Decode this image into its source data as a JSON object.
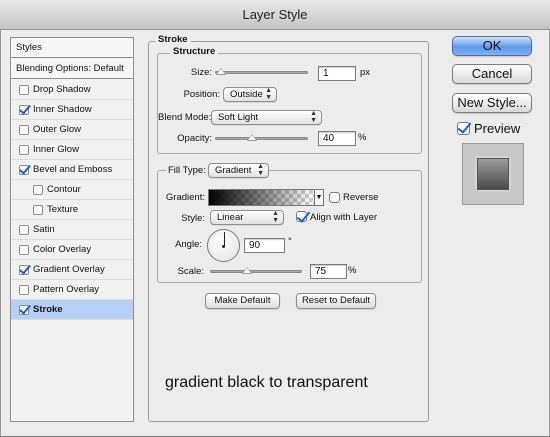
{
  "window": {
    "title": "Layer Style"
  },
  "styles_list": {
    "header": "Styles",
    "blending_options": "Blending Options: Default",
    "items": [
      {
        "label": "Drop Shadow",
        "checked": false,
        "indent": false,
        "selected": false
      },
      {
        "label": "Inner Shadow",
        "checked": true,
        "indent": false,
        "selected": false
      },
      {
        "label": "Outer Glow",
        "checked": false,
        "indent": false,
        "selected": false
      },
      {
        "label": "Inner Glow",
        "checked": false,
        "indent": false,
        "selected": false
      },
      {
        "label": "Bevel and Emboss",
        "checked": true,
        "indent": false,
        "selected": false
      },
      {
        "label": "Contour",
        "checked": false,
        "indent": true,
        "selected": false
      },
      {
        "label": "Texture",
        "checked": false,
        "indent": true,
        "selected": false
      },
      {
        "label": "Satin",
        "checked": false,
        "indent": false,
        "selected": false
      },
      {
        "label": "Color Overlay",
        "checked": false,
        "indent": false,
        "selected": false
      },
      {
        "label": "Gradient Overlay",
        "checked": true,
        "indent": false,
        "selected": false
      },
      {
        "label": "Pattern Overlay",
        "checked": false,
        "indent": false,
        "selected": false
      },
      {
        "label": "Stroke",
        "checked": true,
        "indent": false,
        "selected": true
      }
    ]
  },
  "stroke": {
    "title": "Stroke",
    "structure": {
      "title": "Structure",
      "size_label": "Size:",
      "size_value": "1",
      "size_unit": "px",
      "size_slider_fraction": 0.0,
      "position_label": "Position:",
      "position_value": "Outside",
      "blend_mode_label": "Blend Mode:",
      "blend_mode_value": "Soft Light",
      "opacity_label": "Opacity:",
      "opacity_value": "40",
      "opacity_unit": "%",
      "opacity_slider_fraction": 0.4
    },
    "fill": {
      "fill_type_label": "Fill Type:",
      "fill_type_value": "Gradient",
      "gradient_label": "Gradient:",
      "reverse_label": "Reverse",
      "reverse_checked": false,
      "style_label": "Style:",
      "style_value": "Linear",
      "align_label": "Align with Layer",
      "align_checked": true,
      "angle_label": "Angle:",
      "angle_value": "90",
      "angle_unit": "°",
      "scale_label": "Scale:",
      "scale_value": "75",
      "scale_unit": "%",
      "scale_slider_fraction": 0.4
    },
    "make_default_label": "Make Default",
    "reset_default_label": "Reset to Default"
  },
  "actions": {
    "ok_label": "OK",
    "cancel_label": "Cancel",
    "new_style_label": "New Style...",
    "preview_label": "Preview",
    "preview_checked": true
  },
  "annotation": "gradient black to transparent"
}
